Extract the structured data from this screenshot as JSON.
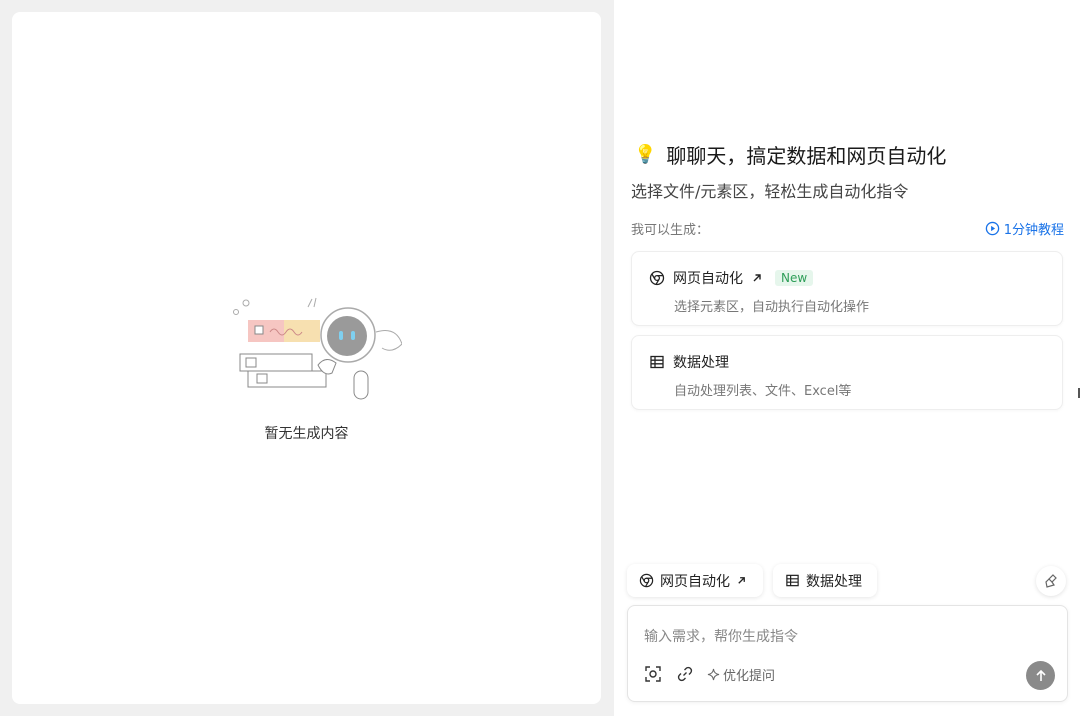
{
  "left": {
    "empty_text": "暂无生成内容"
  },
  "right": {
    "headline": "聊聊天，搞定数据和网页自动化",
    "subline": "选择文件/元素区，轻松生成自动化指令",
    "can_generate_label": "我可以生成：",
    "tutorial_label": "1分钟教程",
    "cards": [
      {
        "title": "网页自动化",
        "badge": "New",
        "desc": "选择元素区，自动执行自动化操作"
      },
      {
        "title": "数据处理",
        "desc": "自动处理列表、文件、Excel等"
      }
    ],
    "chips": [
      {
        "label": "网页自动化"
      },
      {
        "label": "数据处理"
      }
    ],
    "input": {
      "placeholder": "输入需求，帮你生成指令",
      "value": "",
      "optimize_label": "优化提问"
    }
  },
  "colors": {
    "accent": "#1a73e8",
    "badge_green": "#2e9e58",
    "send_button": "#8a8a8a"
  },
  "icons": [
    "lightbulb-icon",
    "chrome-icon",
    "arrow-up-right-icon",
    "table-icon",
    "play-circle-icon",
    "broom-icon",
    "scan-icon",
    "link-icon",
    "sparkle-icon",
    "arrow-up-icon"
  ]
}
